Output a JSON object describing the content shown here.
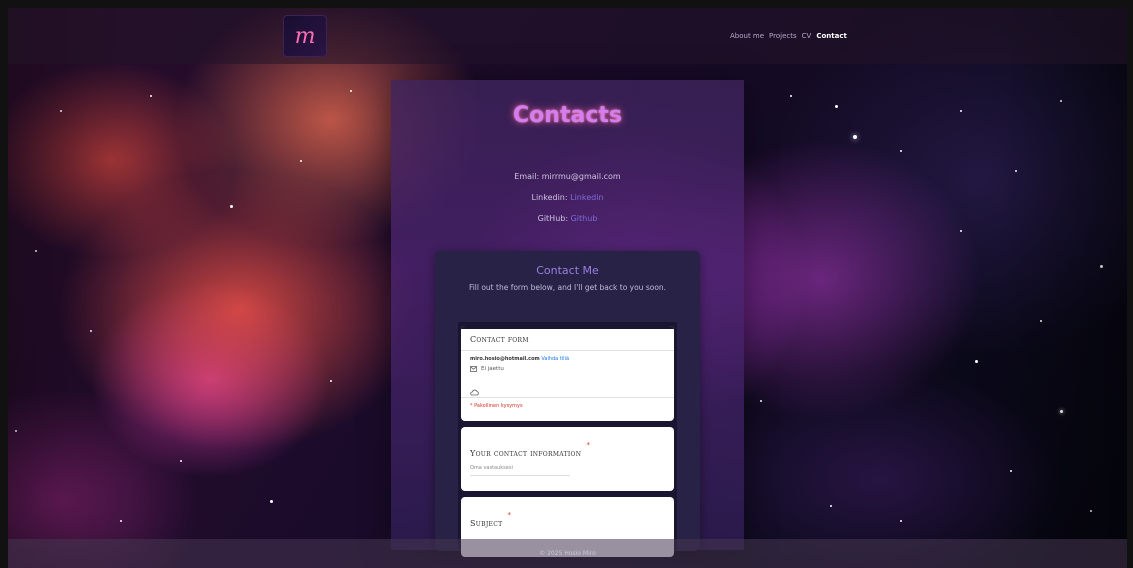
{
  "header": {
    "logo_text": "m",
    "nav": [
      {
        "label": "About me",
        "active": false
      },
      {
        "label": "Projects",
        "active": false
      },
      {
        "label": "CV",
        "active": false
      },
      {
        "label": "Contact",
        "active": true
      }
    ]
  },
  "main": {
    "title": "Contacts",
    "email_label": "Email:",
    "email_value": "mirrmu@gmail.com",
    "linkedin_label": "Linkedin:",
    "linkedin_link": "Linkedin",
    "github_label": "GitHub:",
    "github_link": "Github"
  },
  "contact_card": {
    "title": "Contact Me",
    "subtitle": "Fill out the form below, and I'll get back to you soon."
  },
  "form": {
    "heading": "Contact form",
    "account_email": "miro.hosio@hotmail.com",
    "switch_account": "Vaihda tiliä",
    "not_shared": "Ei jaettu",
    "required_note": "* Pakollinen kysymys",
    "q1_title": "Your contact information",
    "q1_placeholder": "Oma vastauksesi",
    "q2_title": "Subject",
    "required_mark": "*"
  },
  "footer": {
    "text": "© 2025 Hosio Miro"
  },
  "colors": {
    "accent": "#d27ef0",
    "card_bg": "#272246",
    "link": "#7d6cd8",
    "required": "#d93025"
  }
}
